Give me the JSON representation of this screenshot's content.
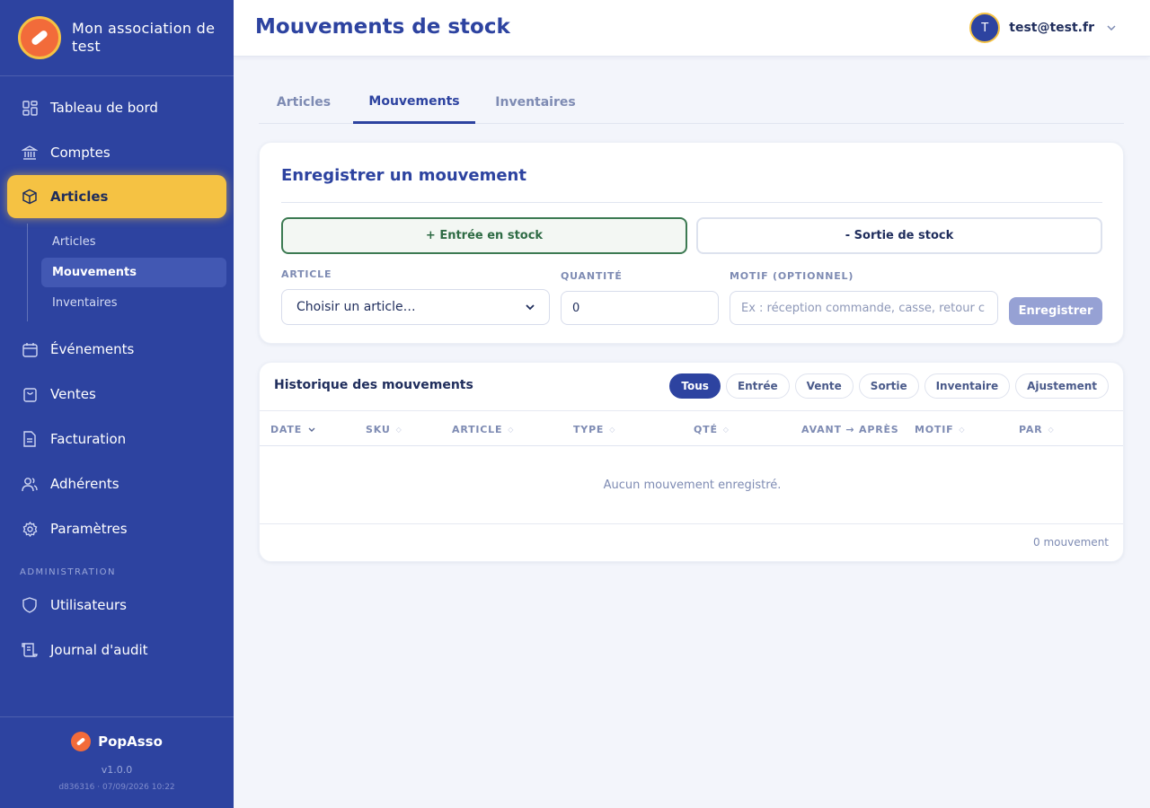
{
  "org": {
    "name": "Mon association de test"
  },
  "nav": {
    "items": [
      {
        "label": "Tableau de bord",
        "icon": "dashboard-icon"
      },
      {
        "label": "Comptes",
        "icon": "bank-icon"
      },
      {
        "label": "Articles",
        "icon": "box-icon"
      },
      {
        "label": "Événements",
        "icon": "calendar-icon"
      },
      {
        "label": "Ventes",
        "icon": "shopping-bag-icon"
      },
      {
        "label": "Facturation",
        "icon": "invoice-icon"
      },
      {
        "label": "Adhérents",
        "icon": "users-icon"
      },
      {
        "label": "Paramètres",
        "icon": "gear-icon"
      }
    ],
    "subitems": [
      {
        "label": "Articles"
      },
      {
        "label": "Mouvements"
      },
      {
        "label": "Inventaires"
      }
    ],
    "admin_label": "ADMINISTRATION",
    "admin_items": [
      {
        "label": "Utilisateurs",
        "icon": "shield-icon"
      },
      {
        "label": "Journal d'audit",
        "icon": "scroll-icon"
      }
    ]
  },
  "footer": {
    "brand": "PopAsso",
    "version": "v1.0.0",
    "build": "d836316 · 07/09/2026 10:22"
  },
  "header": {
    "title": "Mouvements de stock",
    "user_initial": "T",
    "user_email": "test@test.fr"
  },
  "tabs": [
    {
      "label": "Articles"
    },
    {
      "label": "Mouvements"
    },
    {
      "label": "Inventaires"
    }
  ],
  "form": {
    "title": "Enregistrer un mouvement",
    "entry_label": "+ Entrée en stock",
    "exit_label": "- Sortie de stock",
    "article_label": "ARTICLE",
    "article_value": "Choisir un article…",
    "quantity_label": "QUANTITÉ",
    "quantity_value": "0",
    "motif_label": "MOTIF (OPTIONNEL)",
    "motif_placeholder": "Ex : réception commande, casse, retour c",
    "save_label": "Enregistrer"
  },
  "history": {
    "title": "Historique des mouvements",
    "filters": [
      "Tous",
      "Entrée",
      "Vente",
      "Sortie",
      "Inventaire",
      "Ajustement"
    ],
    "columns": [
      "DATE",
      "SKU",
      "ARTICLE",
      "TYPE",
      "QTÉ",
      "AVANT → APRÈS",
      "MOTIF",
      "PAR"
    ],
    "empty_text": "Aucun mouvement enregistré.",
    "count_text": "0 mouvement"
  },
  "colors": {
    "sidebar": "#2d43a0",
    "accent": "#f5c243",
    "brand_orange": "#f26b3a",
    "entry_green": "#3c7a52"
  }
}
